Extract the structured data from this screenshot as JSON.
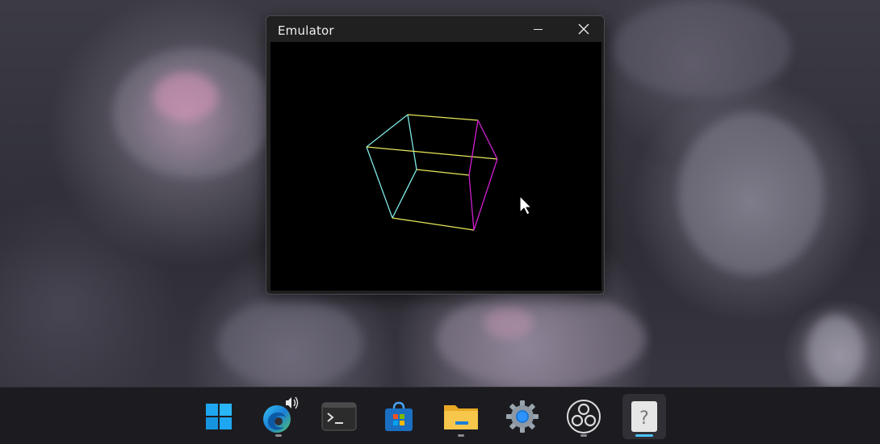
{
  "window": {
    "title": "Emulator",
    "controls": {
      "minimize_icon": "minimize-icon",
      "close_icon": "close-icon"
    }
  },
  "scene": {
    "description_colors": {
      "background": "#000000",
      "edge_cyan": "#7fe9e4",
      "edge_yellow": "#e8e85a",
      "edge_magenta": "#d21fd2"
    }
  },
  "taskbar": {
    "apps": [
      {
        "name": "start",
        "icon": "windows-start-icon",
        "running": false,
        "focused": false
      },
      {
        "name": "edge",
        "icon": "edge-browser-icon",
        "running": true,
        "focused": false,
        "audio": "speaker-icon"
      },
      {
        "name": "terminal",
        "icon": "terminal-icon",
        "running": false,
        "focused": false,
        "glyph": ">_"
      },
      {
        "name": "store",
        "icon": "microsoft-store-icon",
        "running": false,
        "focused": false
      },
      {
        "name": "explorer",
        "icon": "file-explorer-icon",
        "running": true,
        "focused": false
      },
      {
        "name": "settings",
        "icon": "settings-gear-icon",
        "running": false,
        "focused": false
      },
      {
        "name": "obs",
        "icon": "obs-studio-icon",
        "running": true,
        "focused": false
      },
      {
        "name": "unknown",
        "icon": "unknown-app-icon",
        "running": true,
        "focused": true,
        "glyph": "?"
      }
    ]
  }
}
